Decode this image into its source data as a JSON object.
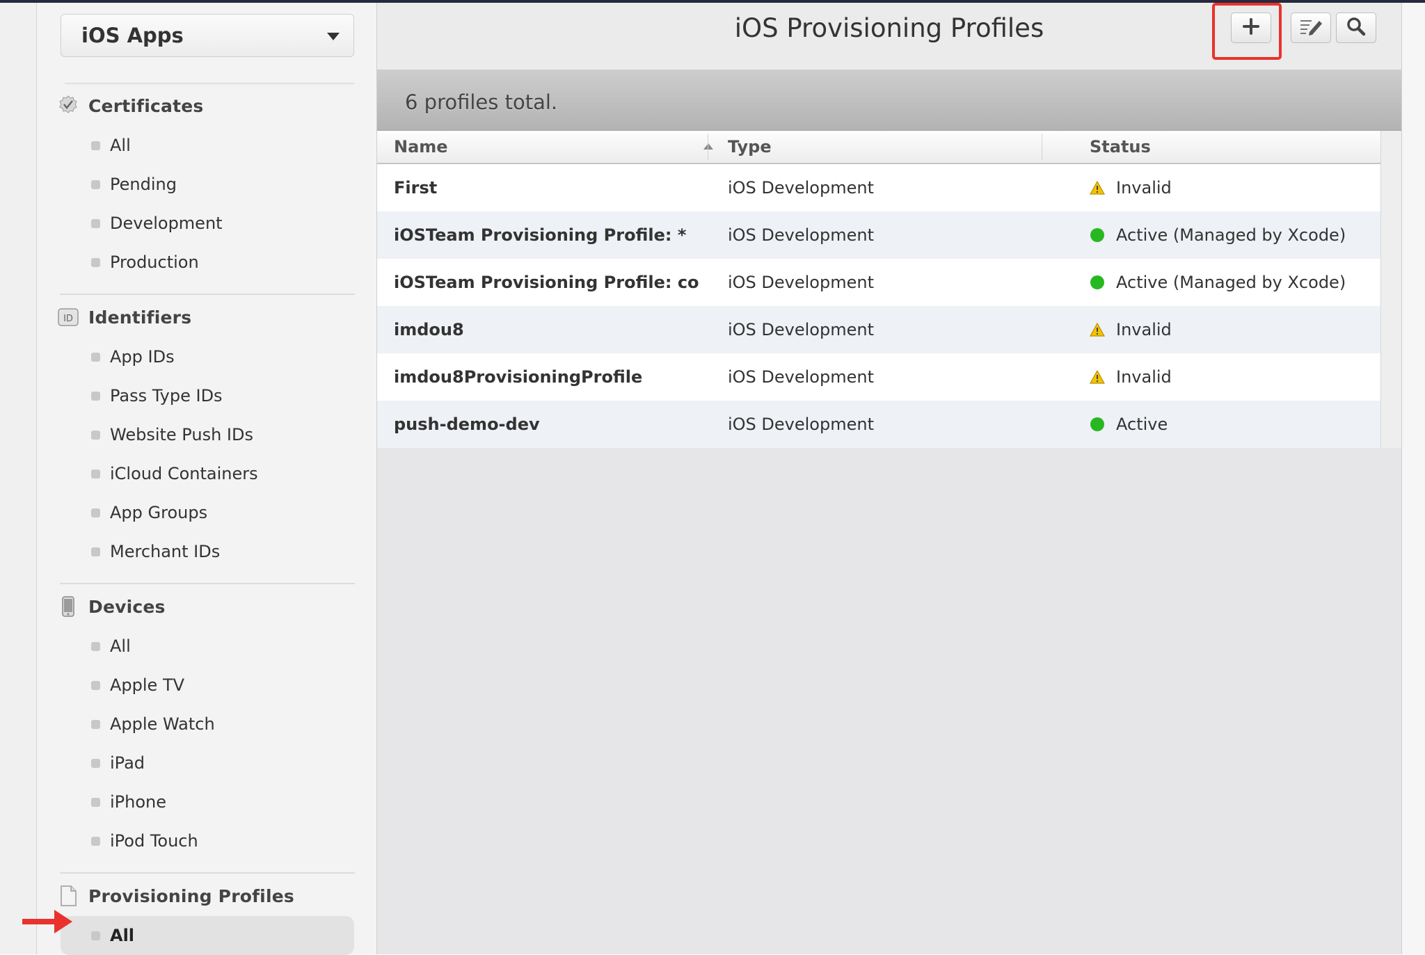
{
  "app_selector": {
    "value": "iOS Apps"
  },
  "sidebar": {
    "sections": [
      {
        "title": "Certificates",
        "icon": "certificate-badge-icon",
        "items": [
          {
            "label": "All"
          },
          {
            "label": "Pending"
          },
          {
            "label": "Development"
          },
          {
            "label": "Production"
          }
        ]
      },
      {
        "title": "Identifiers",
        "icon": "id-badge-icon",
        "items": [
          {
            "label": "App IDs"
          },
          {
            "label": "Pass Type IDs"
          },
          {
            "label": "Website Push IDs"
          },
          {
            "label": "iCloud Containers"
          },
          {
            "label": "App Groups"
          },
          {
            "label": "Merchant IDs"
          }
        ]
      },
      {
        "title": "Devices",
        "icon": "device-icon",
        "items": [
          {
            "label": "All"
          },
          {
            "label": "Apple TV"
          },
          {
            "label": "Apple Watch"
          },
          {
            "label": "iPad"
          },
          {
            "label": "iPhone"
          },
          {
            "label": "iPod Touch"
          }
        ]
      },
      {
        "title": "Provisioning Profiles",
        "icon": "document-icon",
        "items": [
          {
            "label": "All",
            "selected": true
          }
        ]
      }
    ]
  },
  "header": {
    "title": "iOS Provisioning Profiles",
    "buttons": [
      "add-icon",
      "edit-icon",
      "search-icon"
    ]
  },
  "count_text": "6 profiles total.",
  "table": {
    "columns": [
      "Name",
      "Type",
      "Status"
    ],
    "sort": {
      "column": "Name",
      "direction": "ascending"
    },
    "rows": [
      {
        "name": "First",
        "type": "iOS Development",
        "status": "Invalid",
        "status_icon": "warning-icon"
      },
      {
        "name": "iOSTeam Provisioning Profile: *",
        "type": "iOS Development",
        "status": "Active (Managed by Xcode)",
        "status_icon": "active-dot-icon"
      },
      {
        "name": "iOSTeam Provisioning Profile: co...",
        "type": "iOS Development",
        "status": "Active (Managed by Xcode)",
        "status_icon": "active-dot-icon"
      },
      {
        "name": "imdou8",
        "type": "iOS Development",
        "status": "Invalid",
        "status_icon": "warning-icon"
      },
      {
        "name": "imdou8ProvisioningProfile",
        "type": "iOS Development",
        "status": "Invalid",
        "status_icon": "warning-icon"
      },
      {
        "name": "push-demo-dev",
        "type": "iOS Development",
        "status": "Active",
        "status_icon": "active-dot-icon"
      }
    ]
  },
  "colors": {
    "annotation_red": "#e9322d",
    "active_green": "#27b821",
    "warning_yellow": "#f2c400"
  }
}
